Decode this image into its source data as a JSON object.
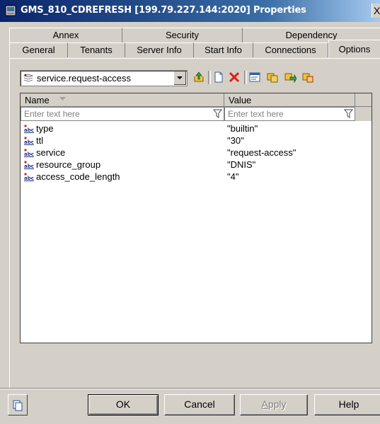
{
  "window": {
    "title": "GMS_810_CDREFRESH [199.79.227.144:2020] Properties",
    "close_glyph": "X"
  },
  "tabs_back": [
    {
      "label": "Annex"
    },
    {
      "label": "Security"
    },
    {
      "label": "Dependency"
    }
  ],
  "tabs_front": [
    {
      "label": "General"
    },
    {
      "label": "Tenants"
    },
    {
      "label": "Server Info"
    },
    {
      "label": "Start Info"
    },
    {
      "label": "Connections"
    },
    {
      "label": "Options"
    }
  ],
  "active_tab": "Options",
  "section_selector": {
    "value": "service.request-access"
  },
  "grid": {
    "columns": [
      {
        "label": "Name"
      },
      {
        "label": "Value"
      }
    ],
    "filter_placeholder": {
      "name": "Enter text here",
      "value": "Enter text here"
    },
    "rows": [
      {
        "name": "type",
        "value": "\"builtin\""
      },
      {
        "name": "ttl",
        "value": "\"30\""
      },
      {
        "name": "service",
        "value": "\"request-access\""
      },
      {
        "name": "resource_group",
        "value": "\"DNIS\""
      },
      {
        "name": "access_code_length",
        "value": "\"4\""
      }
    ]
  },
  "buttons": {
    "ok": "OK",
    "cancel": "Cancel",
    "apply_first": "A",
    "apply_rest": "pply",
    "help": "Help"
  },
  "colors": {
    "title_bar": "#0a246a",
    "face": "#d4d0c8",
    "grid_bg": "#ffffff"
  }
}
